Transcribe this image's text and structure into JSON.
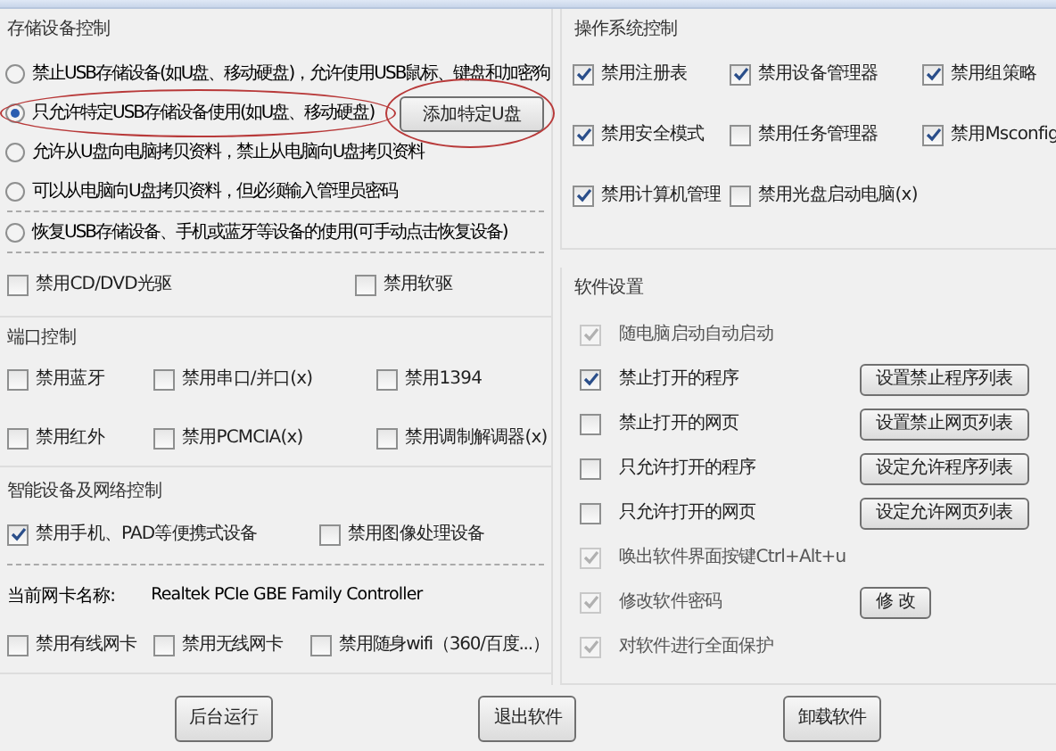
{
  "storage": {
    "title": "存储设备控制",
    "radio_groups": [
      [
        {
          "label": "禁止USB存储设备(如U盘、移动硬盘)，允许使用USB鼠标、键盘和加密狗",
          "selected": false,
          "highlighted": false
        },
        {
          "label": "只允许特定USB存储设备使用(如U盘、移动硬盘)",
          "selected": true,
          "highlighted": true,
          "button": {
            "label": "添加特定U盘",
            "highlighted": true
          }
        },
        {
          "label": "允许从U盘向电脑拷贝资料，禁止从电脑向U盘拷贝资料",
          "selected": false,
          "highlighted": false
        },
        {
          "label": "可以从电脑向U盘拷贝资料，但必须输入管理员密码",
          "selected": false,
          "highlighted": false
        }
      ],
      [
        {
          "label": "恢复USB存储设备、手机或蓝牙等设备的使用(可手动点击恢复设备)",
          "selected": false,
          "highlighted": false
        }
      ]
    ],
    "drives": [
      {
        "label": "禁用CD/DVD光驱",
        "checked": false
      },
      {
        "label": "禁用软驱",
        "checked": false
      }
    ]
  },
  "ports": {
    "title": "端口控制",
    "items": [
      {
        "label": "禁用蓝牙",
        "checked": false
      },
      {
        "label": "禁用串口/并口(x)",
        "checked": false
      },
      {
        "label": "禁用1394",
        "checked": false
      },
      {
        "label": "禁用红外",
        "checked": false
      },
      {
        "label": "禁用PCMCIA(x)",
        "checked": false
      },
      {
        "label": "禁用调制解调器(x)",
        "checked": false
      }
    ]
  },
  "smart": {
    "title": "智能设备及网络控制",
    "items": [
      {
        "label": "禁用手机、PAD等便携式设备",
        "checked": true
      },
      {
        "label": "禁用图像处理设备",
        "checked": false
      }
    ],
    "netcard_label": "当前网卡名称:",
    "netcard_value": "Realtek PCIe GBE Family Controller",
    "net_items": [
      {
        "label": "禁用有线网卡",
        "checked": false
      },
      {
        "label": "禁用无线网卡",
        "checked": false
      },
      {
        "label": "禁用随身wifi（360/百度...）",
        "checked": false
      }
    ]
  },
  "os": {
    "title": "操作系统控制",
    "items": [
      {
        "label": "禁用注册表",
        "checked": true
      },
      {
        "label": "禁用设备管理器",
        "checked": true
      },
      {
        "label": "禁用组策略",
        "checked": true
      },
      {
        "label": "禁用安全模式",
        "checked": true
      },
      {
        "label": "禁用任务管理器",
        "checked": false
      },
      {
        "label": "禁用Msconfig",
        "checked": true
      },
      {
        "label": "禁用计算机管理",
        "checked": true
      },
      {
        "label": "禁用光盘启动电脑(x)",
        "checked": false
      }
    ]
  },
  "software": {
    "title": "软件设置",
    "items": [
      {
        "label": "随电脑启动自动启动",
        "checked": true,
        "disabled": true
      },
      {
        "label": "禁止打开的程序",
        "checked": true,
        "disabled": false,
        "button": "设置禁止程序列表"
      },
      {
        "label": "禁止打开的网页",
        "checked": false,
        "disabled": false,
        "button": "设置禁止网页列表"
      },
      {
        "label": "只允许打开的程序",
        "checked": false,
        "disabled": false,
        "button": "设定允许程序列表"
      },
      {
        "label": "只允许打开的网页",
        "checked": false,
        "disabled": false,
        "button": "设定允许网页列表"
      },
      {
        "label": "唤出软件界面按键Ctrl+Alt+u",
        "checked": true,
        "disabled": true
      },
      {
        "label": "修改软件密码",
        "checked": true,
        "disabled": true,
        "button": "修 改"
      },
      {
        "label": "对软件进行全面保护",
        "checked": true,
        "disabled": true
      }
    ]
  },
  "footer_buttons": [
    "后台运行",
    "退出软件",
    "卸载软件"
  ]
}
